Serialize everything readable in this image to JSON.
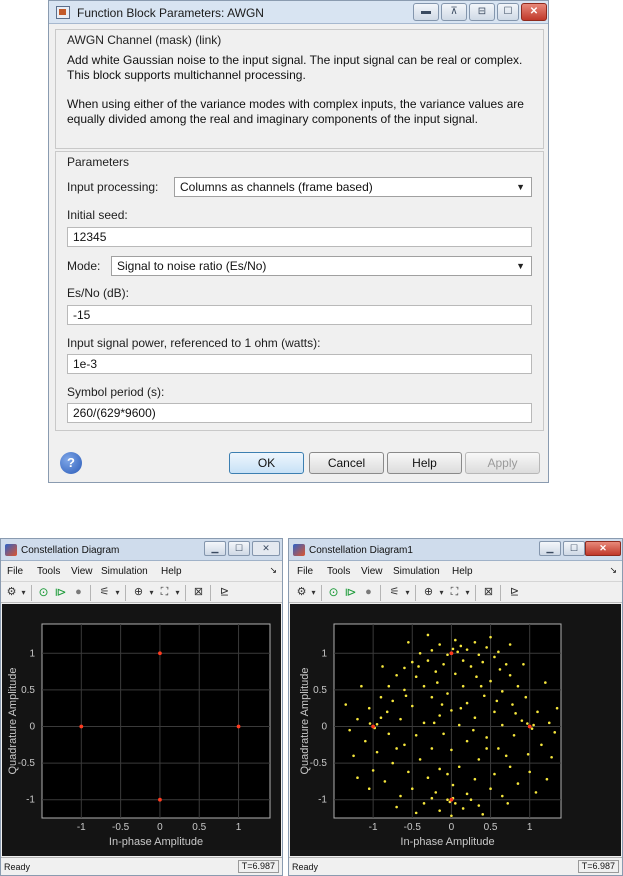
{
  "dialog": {
    "title": "Function Block Parameters: AWGN",
    "mask_title": "AWGN Channel (mask) (link)",
    "description_1": "Add white Gaussian noise to the input signal. The input signal can be real or complex. This block supports multichannel processing.",
    "description_2": "When using either of the variance modes with complex inputs, the variance values are equally divided among the real and imaginary components of the input signal.",
    "params_title": "Parameters",
    "input_processing_label": "Input processing:",
    "input_processing_value": "Columns as channels (frame based)",
    "initial_seed_label": "Initial seed:",
    "initial_seed_value": "12345",
    "mode_label": "Mode:",
    "mode_value": "Signal to noise ratio  (Es/No)",
    "esno_label": "Es/No (dB):",
    "esno_value": "-15",
    "power_label": "Input signal power, referenced to 1 ohm (watts):",
    "power_value": "1e-3",
    "symbol_period_label": "Symbol period (s):",
    "symbol_period_value": "260/(629*9600)",
    "buttons": {
      "ok": "OK",
      "cancel": "Cancel",
      "help": "Help",
      "apply": "Apply"
    },
    "help_glyph": "?"
  },
  "scope_left": {
    "title": "Constellation Diagram",
    "menu": [
      "File",
      "Tools",
      "View",
      "Simulation",
      "Help"
    ],
    "status": "Ready",
    "time": "T=6.987"
  },
  "scope_right": {
    "title": "Constellation Diagram1",
    "menu": [
      "File",
      "Tools",
      "View",
      "Simulation",
      "Help"
    ],
    "status": "Ready",
    "time": "T=6.987"
  },
  "chart_data": [
    {
      "type": "scatter",
      "xlabel": "In-phase Amplitude",
      "ylabel": "Quadrature Amplitude",
      "xlim": [
        -1.5,
        1.4
      ],
      "ylim": [
        -1.25,
        1.4
      ],
      "xticks": [
        -1,
        -0.5,
        0,
        0.5,
        1
      ],
      "yticks": [
        -1,
        -0.5,
        0,
        0.5,
        1
      ],
      "x_tick_labels": [
        "-1",
        "-0.5",
        "0",
        "0.5",
        "1"
      ],
      "y_tick_labels": [
        "-1",
        "-0.5",
        "0",
        "0.5",
        "1"
      ],
      "grid": true,
      "reference_points": [
        [
          1,
          0
        ],
        [
          0,
          1
        ],
        [
          -1,
          0
        ],
        [
          0,
          -1
        ]
      ],
      "received_points": [
        [
          1,
          0
        ],
        [
          0,
          1
        ],
        [
          -1,
          0
        ],
        [
          0,
          -1
        ]
      ],
      "reference_color": "#ff3b1f",
      "received_color": "#f5e63c"
    },
    {
      "type": "scatter",
      "xlabel": "In-phase Amplitude",
      "ylabel": "Quadrature Amplitude",
      "xlim": [
        -1.5,
        1.4
      ],
      "ylim": [
        -1.25,
        1.4
      ],
      "xticks": [
        -1,
        -0.5,
        0,
        0.5,
        1
      ],
      "yticks": [
        -1,
        -0.5,
        0,
        0.5,
        1
      ],
      "x_tick_labels": [
        "-1",
        "-0.5",
        "0",
        "0.5",
        "1"
      ],
      "y_tick_labels": [
        "-1",
        "-0.5",
        "0",
        "0.5",
        "1"
      ],
      "grid": true,
      "reference_points": [
        [
          1,
          0
        ],
        [
          0,
          1
        ],
        [
          -1,
          0
        ],
        [
          0,
          -1
        ]
      ],
      "reference_color": "#ff3b1f",
      "received_color": "#f5e63c",
      "received_points": [
        [
          0.02,
          1.06
        ],
        [
          0.08,
          1.02
        ],
        [
          -0.05,
          0.98
        ],
        [
          0.12,
          1.1
        ],
        [
          0.2,
          1.05
        ],
        [
          -0.15,
          1.12
        ],
        [
          0.3,
          1.15
        ],
        [
          0.05,
          1.18
        ],
        [
          -0.25,
          1.04
        ],
        [
          0.35,
          0.98
        ],
        [
          -0.4,
          1.0
        ],
        [
          0.45,
          1.08
        ],
        [
          -0.3,
          0.9
        ],
        [
          0.15,
          0.9
        ],
        [
          0.25,
          0.82
        ],
        [
          -0.1,
          0.85
        ],
        [
          0.4,
          0.88
        ],
        [
          0.55,
          0.95
        ],
        [
          -0.5,
          0.88
        ],
        [
          0.6,
          1.02
        ],
        [
          -0.6,
          0.8
        ],
        [
          0.7,
          0.85
        ],
        [
          -0.7,
          0.7
        ],
        [
          0.75,
          0.7
        ],
        [
          -0.2,
          0.75
        ],
        [
          0.05,
          0.72
        ],
        [
          0.32,
          0.68
        ],
        [
          -0.45,
          0.68
        ],
        [
          0.5,
          0.62
        ],
        [
          -0.8,
          0.55
        ],
        [
          0.85,
          0.55
        ],
        [
          -0.35,
          0.55
        ],
        [
          0.15,
          0.55
        ],
        [
          0.65,
          0.48
        ],
        [
          -0.6,
          0.5
        ],
        [
          -0.9,
          0.4
        ],
        [
          0.95,
          0.4
        ],
        [
          -0.05,
          0.45
        ],
        [
          0.42,
          0.42
        ],
        [
          -0.25,
          0.4
        ],
        [
          0.2,
          0.32
        ],
        [
          -0.75,
          0.35
        ],
        [
          0.78,
          0.3
        ],
        [
          -1.05,
          0.25
        ],
        [
          1.1,
          0.2
        ],
        [
          -0.5,
          0.28
        ],
        [
          0.55,
          0.2
        ],
        [
          0.0,
          0.22
        ],
        [
          -0.15,
          0.15
        ],
        [
          0.3,
          0.12
        ],
        [
          -0.9,
          0.12
        ],
        [
          0.9,
          0.08
        ],
        [
          -1.2,
          0.1
        ],
        [
          1.25,
          0.05
        ],
        [
          -0.65,
          0.1
        ],
        [
          0.65,
          0.02
        ],
        [
          -0.35,
          0.05
        ],
        [
          0.1,
          0.02
        ],
        [
          -1.0,
          0.0
        ],
        [
          -0.98,
          -0.02
        ],
        [
          -1.04,
          0.04
        ],
        [
          -0.95,
          0.03
        ],
        [
          1.0,
          0.0
        ],
        [
          1.03,
          -0.03
        ],
        [
          0.97,
          0.04
        ],
        [
          1.05,
          0.02
        ],
        [
          -1.3,
          -0.05
        ],
        [
          1.32,
          -0.08
        ],
        [
          -0.8,
          -0.1
        ],
        [
          0.8,
          -0.12
        ],
        [
          -0.45,
          -0.12
        ],
        [
          0.45,
          -0.15
        ],
        [
          -0.1,
          -0.1
        ],
        [
          0.2,
          -0.2
        ],
        [
          -1.1,
          -0.2
        ],
        [
          1.15,
          -0.25
        ],
        [
          -0.6,
          -0.25
        ],
        [
          0.6,
          -0.3
        ],
        [
          -0.25,
          -0.3
        ],
        [
          0.0,
          -0.32
        ],
        [
          -0.95,
          -0.35
        ],
        [
          0.98,
          -0.38
        ],
        [
          -1.25,
          -0.4
        ],
        [
          1.28,
          -0.42
        ],
        [
          -0.4,
          -0.45
        ],
        [
          0.35,
          -0.45
        ],
        [
          -0.75,
          -0.5
        ],
        [
          0.75,
          -0.55
        ],
        [
          0.1,
          -0.55
        ],
        [
          -0.15,
          -0.58
        ],
        [
          -0.55,
          -0.62
        ],
        [
          0.55,
          -0.65
        ],
        [
          -1.0,
          -0.6
        ],
        [
          1.0,
          -0.62
        ],
        [
          -0.3,
          -0.7
        ],
        [
          0.3,
          -0.72
        ],
        [
          -0.85,
          -0.75
        ],
        [
          0.85,
          -0.78
        ],
        [
          0.02,
          -0.8
        ],
        [
          -0.5,
          -0.85
        ],
        [
          0.5,
          -0.85
        ],
        [
          -0.2,
          -0.9
        ],
        [
          0.2,
          -0.92
        ],
        [
          -0.65,
          -0.95
        ],
        [
          0.65,
          -0.95
        ],
        [
          -0.05,
          -1.0
        ],
        [
          0.02,
          -0.98
        ],
        [
          -0.02,
          -1.03
        ],
        [
          0.05,
          -1.05
        ],
        [
          -0.35,
          -1.05
        ],
        [
          0.35,
          -1.08
        ],
        [
          -0.15,
          -1.15
        ],
        [
          0.15,
          -1.12
        ],
        [
          -0.45,
          -1.18
        ],
        [
          0.4,
          -1.2
        ],
        [
          0.0,
          -1.22
        ],
        [
          -0.25,
          -0.98
        ],
        [
          0.25,
          -1.0
        ],
        [
          -0.7,
          -1.1
        ],
        [
          0.72,
          -1.05
        ],
        [
          -1.15,
          0.55
        ],
        [
          1.2,
          0.6
        ],
        [
          -1.2,
          -0.7
        ],
        [
          1.22,
          -0.72
        ],
        [
          -0.3,
          1.25
        ],
        [
          0.5,
          1.22
        ],
        [
          -0.55,
          1.15
        ],
        [
          0.75,
          1.12
        ],
        [
          -1.35,
          0.3
        ],
        [
          1.35,
          0.25
        ],
        [
          -0.42,
          0.82
        ],
        [
          0.62,
          0.78
        ],
        [
          -0.88,
          0.82
        ],
        [
          0.92,
          0.85
        ],
        [
          -0.18,
          0.6
        ],
        [
          0.38,
          0.55
        ],
        [
          -0.7,
          -0.3
        ],
        [
          0.7,
          -0.4
        ],
        [
          -0.05,
          -0.65
        ],
        [
          0.45,
          -0.3
        ],
        [
          -1.05,
          -0.85
        ],
        [
          1.08,
          -0.9
        ],
        [
          -0.22,
          0.05
        ],
        [
          0.28,
          -0.05
        ],
        [
          -0.58,
          0.42
        ],
        [
          0.58,
          0.35
        ],
        [
          -0.82,
          0.2
        ],
        [
          0.82,
          0.18
        ],
        [
          -0.12,
          0.3
        ],
        [
          0.12,
          0.25
        ]
      ]
    }
  ]
}
